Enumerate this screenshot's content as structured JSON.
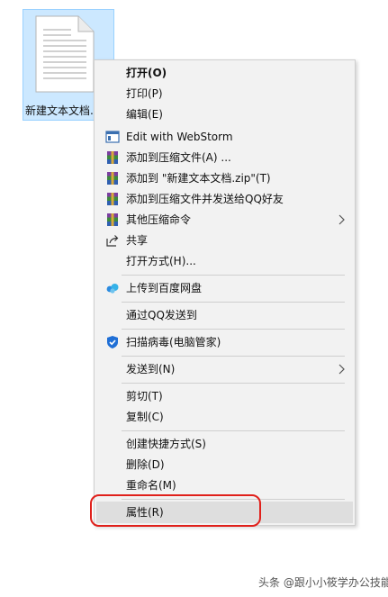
{
  "file": {
    "name": "新建文本文档.t",
    "icon": "text-file-icon"
  },
  "menu": {
    "items": [
      {
        "label": "打开(O)",
        "bold": true
      },
      {
        "label": "打印(P)"
      },
      {
        "label": "编辑(E)"
      },
      {
        "label": "Edit with WebStorm",
        "icon": "webstorm-icon"
      },
      {
        "label": "添加到压缩文件(A) ...",
        "icon": "winrar-icon"
      },
      {
        "label": "添加到 \"新建文本文档.zip\"(T)",
        "icon": "winrar-icon"
      },
      {
        "label": "添加到压缩文件并发送给QQ好友",
        "icon": "winrar-icon"
      },
      {
        "label": "其他压缩命令",
        "icon": "winrar-icon",
        "submenu": true
      },
      {
        "label": "共享",
        "icon": "share-icon"
      },
      {
        "label": "打开方式(H)..."
      },
      {
        "label": "上传到百度网盘",
        "icon": "baidu-netdisk-icon"
      },
      {
        "label": "通过QQ发送到"
      },
      {
        "label": "扫描病毒(电脑管家)",
        "icon": "shield-icon"
      },
      {
        "label": "发送到(N)",
        "submenu": true
      },
      {
        "label": "剪切(T)"
      },
      {
        "label": "复制(C)"
      },
      {
        "label": "创建快捷方式(S)"
      },
      {
        "label": "删除(D)"
      },
      {
        "label": "重命名(M)"
      },
      {
        "label": "属性(R)",
        "highlighted": true
      }
    ]
  },
  "colors": {
    "selection": "#cce8ff",
    "highlight_box": "#e0201b"
  },
  "watermark": "头条 @跟小小筱学办公技能"
}
